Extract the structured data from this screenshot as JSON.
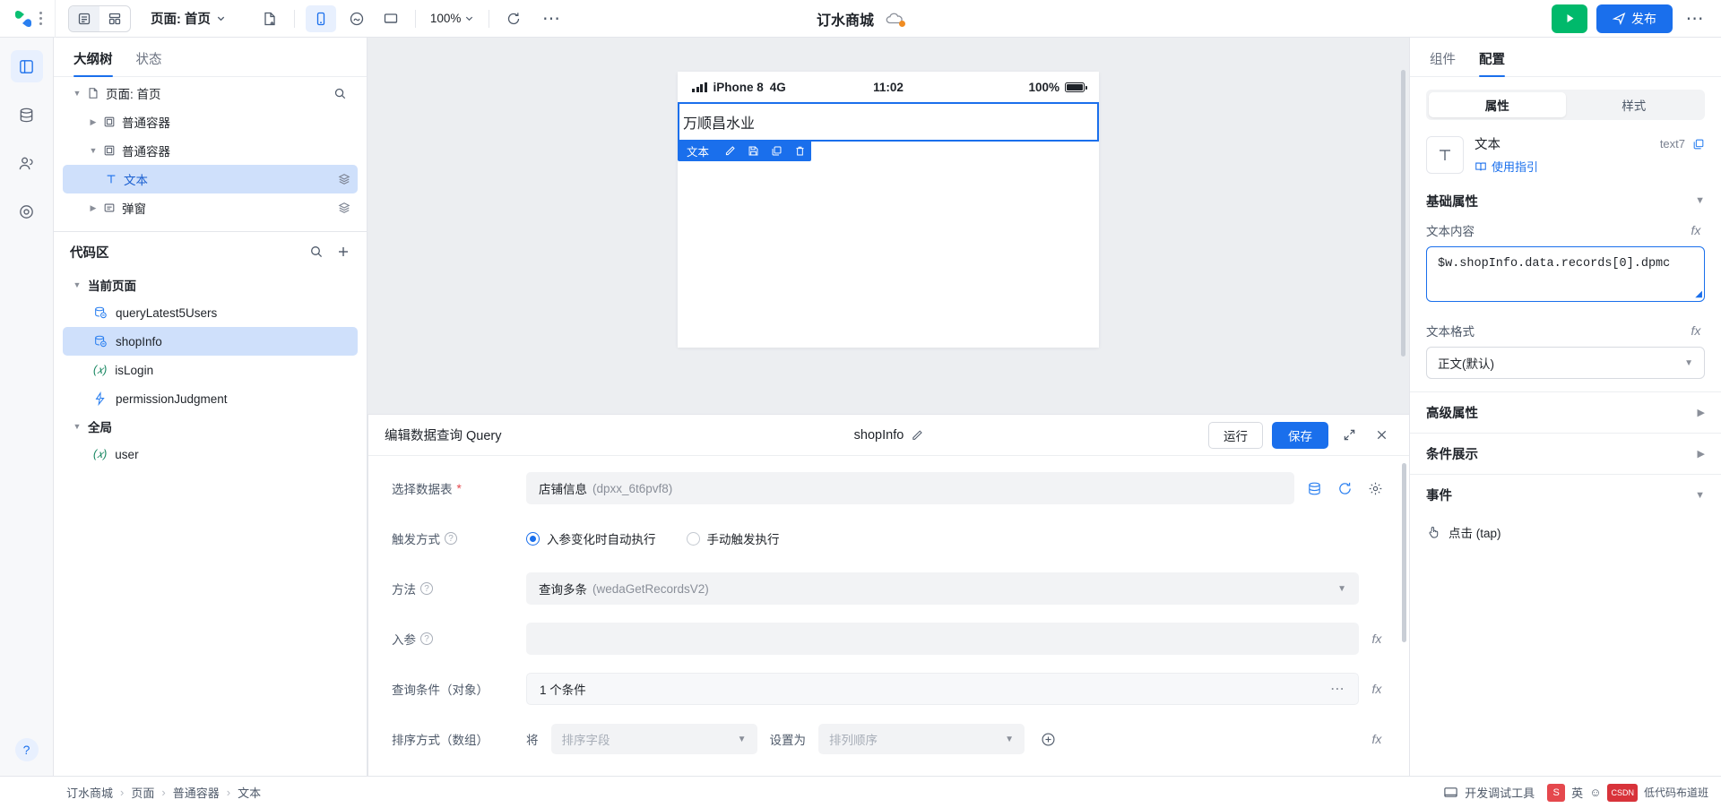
{
  "topbar": {
    "logo_name": "weda-logo",
    "view_toggle": [
      {
        "name": "outline-view-icon",
        "active": true
      },
      {
        "name": "grid-view-icon",
        "active": false
      }
    ],
    "page_selector": "页面: 首页",
    "new_page_icon": "new-page-icon",
    "device_tabs": [
      {
        "name": "mobile-device-icon",
        "active": true
      },
      {
        "name": "mini-program-icon",
        "active": false
      },
      {
        "name": "desktop-device-icon",
        "active": false
      }
    ],
    "zoom_level": "100%",
    "refresh_icon": "refresh-icon",
    "more_icon": "more-horizontal-icon",
    "app_title": "订水商城",
    "cloud_icon": "cloud-status-icon",
    "run_label": "运行",
    "publish_label": "发布"
  },
  "rail": {
    "items": [
      {
        "name": "sidebar-item-components",
        "icon": "layout-panel-icon",
        "active": true
      },
      {
        "name": "sidebar-item-data",
        "icon": "database-icon",
        "active": false
      },
      {
        "name": "sidebar-item-users",
        "icon": "users-icon",
        "active": false
      },
      {
        "name": "sidebar-item-settings",
        "icon": "target-icon",
        "active": false
      }
    ],
    "help_label": "?"
  },
  "leftpanel": {
    "tabs": [
      {
        "label": "大纲树",
        "active": true
      },
      {
        "label": "状态",
        "active": false
      }
    ],
    "search_icon": "search-icon",
    "tree": [
      {
        "label": "页面: 首页",
        "icon": "page-icon",
        "depth": 0,
        "caret": "down",
        "selected": false,
        "badge": ""
      },
      {
        "label": "普通容器",
        "icon": "container-icon",
        "depth": 1,
        "caret": "right",
        "selected": false,
        "badge": ""
      },
      {
        "label": "普通容器",
        "icon": "container-icon",
        "depth": 1,
        "caret": "down",
        "selected": false,
        "badge": ""
      },
      {
        "label": "文本",
        "icon": "text-icon",
        "depth": 2,
        "caret": "none",
        "selected": true,
        "badge": "layers-icon"
      },
      {
        "label": "弹窗",
        "icon": "modal-icon",
        "depth": 1,
        "caret": "right",
        "selected": false,
        "badge": "layers-icon"
      }
    ],
    "codearea": {
      "title": "代码区",
      "search_icon": "search-icon",
      "add_icon": "plus-icon",
      "groups": [
        {
          "label": "当前页面",
          "items": [
            {
              "label": "queryLatest5Users",
              "icon": "query-icon",
              "selected": false
            },
            {
              "label": "shopInfo",
              "icon": "query-icon",
              "selected": true
            },
            {
              "label": "isLogin",
              "icon": "variable-icon",
              "selected": false
            },
            {
              "label": "permissionJudgment",
              "icon": "method-icon",
              "selected": false
            }
          ]
        },
        {
          "label": "全局",
          "items": [
            {
              "label": "user",
              "icon": "variable-icon",
              "selected": false
            }
          ]
        }
      ]
    }
  },
  "canvas": {
    "phone_status": {
      "carrier": "iPhone 8",
      "network": "4G",
      "time": "11:02",
      "battery_text": "100%"
    },
    "selected_component": {
      "text": "万顺昌水业",
      "toolbar_label": "文本",
      "toolbar_icons": [
        "edit-icon",
        "save-icon",
        "copy-icon",
        "delete-icon"
      ]
    }
  },
  "querypanel": {
    "title": "编辑数据查询 Query",
    "name": "shopInfo",
    "edit_icon": "pencil-icon",
    "run_label": "运行",
    "save_label": "保存",
    "expand_icon": "expand-icon",
    "close_icon": "close-icon",
    "fields": {
      "datasource": {
        "label": "选择数据表",
        "required": "*",
        "value": "店铺信息",
        "value_id": "(dpxx_6t6pvf8)",
        "icons": [
          "database-icon",
          "refresh-icon",
          "settings-icon"
        ]
      },
      "trigger": {
        "label": "触发方式",
        "options": [
          {
            "label": "入参变化时自动执行",
            "selected": true
          },
          {
            "label": "手动触发执行",
            "selected": false
          }
        ]
      },
      "method": {
        "label": "方法",
        "value": "查询多条",
        "value_id": "(wedaGetRecordsV2)"
      },
      "params": {
        "label": "入参",
        "value": "",
        "fx": "fx"
      },
      "conditions": {
        "label": "查询条件（对象）",
        "value": "1 个条件",
        "more_icon": "more-horizontal-icon",
        "fx": "fx"
      },
      "sort": {
        "label": "排序方式（数组）",
        "prefix": "将",
        "field_placeholder": "排序字段",
        "middle": "设置为",
        "order_placeholder": "排列顺序",
        "add_icon": "plus-circle-icon",
        "fx": "fx"
      }
    }
  },
  "rightpanel": {
    "tabs": [
      {
        "label": "组件",
        "active": false
      },
      {
        "label": "配置",
        "active": true
      }
    ],
    "segment": [
      {
        "label": "属性",
        "active": true
      },
      {
        "label": "样式",
        "active": false
      }
    ],
    "component": {
      "icon": "text-component-icon",
      "name": "文本",
      "id": "text7",
      "copy_icon": "copy-icon",
      "guide_label": "使用指引",
      "guide_icon": "book-icon"
    },
    "sections": [
      {
        "title": "基础属性",
        "expanded": true
      },
      {
        "title": "高级属性",
        "expanded": false
      },
      {
        "title": "条件展示",
        "expanded": false
      },
      {
        "title": "事件",
        "expanded": true
      }
    ],
    "text_content": {
      "label": "文本内容",
      "fx": "fx",
      "value": "$w.shopInfo.data.records[0].dpmc",
      "resize_icon": "resize-handle-icon"
    },
    "text_format": {
      "label": "文本格式",
      "fx": "fx",
      "value": "正文(默认)"
    },
    "events": [
      {
        "label": "点击 (tap)",
        "icon": "tap-icon"
      }
    ]
  },
  "statusbar": {
    "breadcrumb": [
      "订水商城",
      "页面",
      "普通容器",
      "文本"
    ],
    "debug_label": "开发调试工具",
    "debug_icon": "debug-icon",
    "tray": [
      {
        "name": "sogou-input-icon",
        "label": "S",
        "color": "#e5484d"
      },
      {
        "name": "lang-icon",
        "label": "英",
        "color": "#4e5969"
      },
      {
        "name": "csdn-icon",
        "label": "CSDN",
        "color": "#d8333a"
      },
      {
        "name": "more-tray-icon",
        "label": "低代码布道班",
        "color": "#4e5969"
      }
    ]
  },
  "colors": {
    "accent": "#1a6fec",
    "success": "#00b96b",
    "danger": "#e5484d",
    "selection": "#cfe0fb",
    "canvas_bg": "#eceef1"
  }
}
